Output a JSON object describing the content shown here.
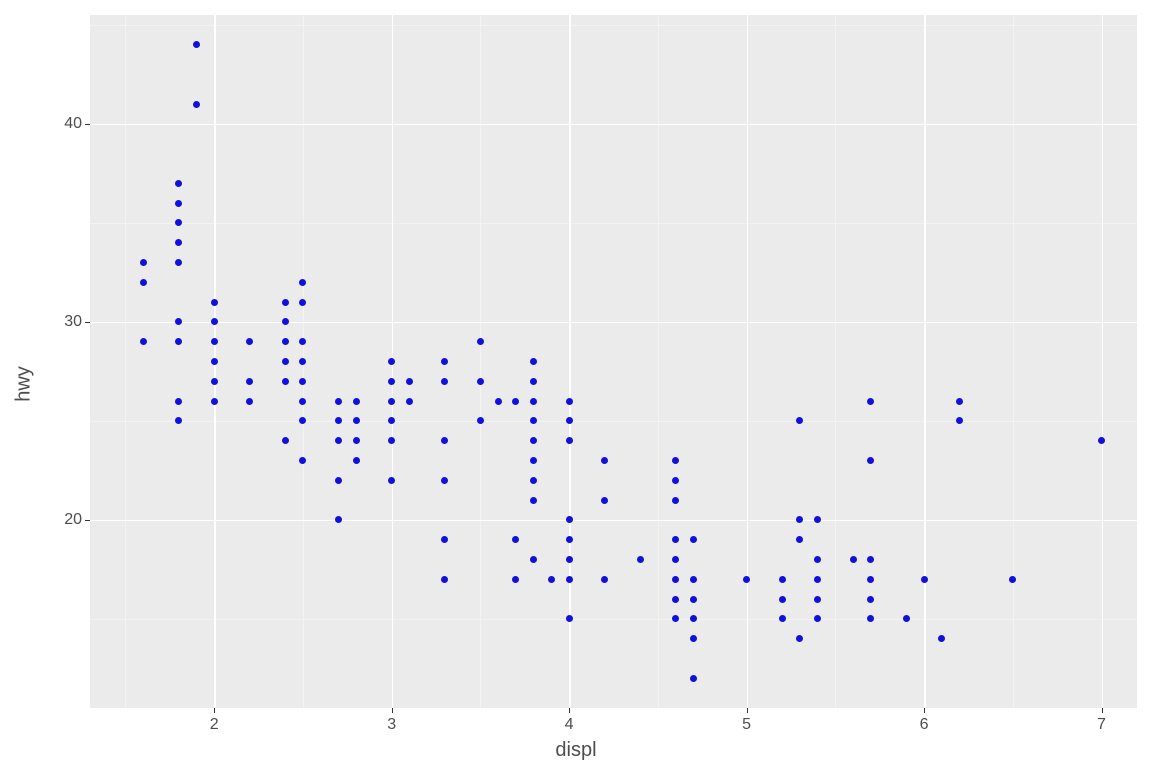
{
  "chart_data": {
    "type": "scatter",
    "xlabel": "displ",
    "ylabel": "hwy",
    "xlim": [
      1.3,
      7.2
    ],
    "ylim": [
      10.5,
      45.5
    ],
    "x_ticks": [
      2,
      3,
      4,
      5,
      6,
      7
    ],
    "y_ticks": [
      20,
      30,
      40
    ],
    "x_minor_ticks": [
      1.5,
      2.5,
      3.5,
      4.5,
      5.5,
      6.5
    ],
    "y_minor_ticks": [
      15,
      25,
      35,
      45
    ],
    "point_color": "#1111dd",
    "points": [
      [
        1.6,
        29
      ],
      [
        1.6,
        32
      ],
      [
        1.6,
        33
      ],
      [
        1.8,
        25
      ],
      [
        1.8,
        26
      ],
      [
        1.8,
        29
      ],
      [
        1.8,
        30
      ],
      [
        1.8,
        33
      ],
      [
        1.8,
        34
      ],
      [
        1.8,
        35
      ],
      [
        1.8,
        36
      ],
      [
        1.8,
        37
      ],
      [
        1.9,
        41
      ],
      [
        1.9,
        44
      ],
      [
        2.0,
        26
      ],
      [
        2.0,
        27
      ],
      [
        2.0,
        28
      ],
      [
        2.0,
        29
      ],
      [
        2.0,
        30
      ],
      [
        2.0,
        31
      ],
      [
        2.2,
        26
      ],
      [
        2.2,
        27
      ],
      [
        2.2,
        29
      ],
      [
        2.4,
        24
      ],
      [
        2.4,
        27
      ],
      [
        2.4,
        28
      ],
      [
        2.4,
        29
      ],
      [
        2.4,
        30
      ],
      [
        2.4,
        31
      ],
      [
        2.5,
        23
      ],
      [
        2.5,
        25
      ],
      [
        2.5,
        26
      ],
      [
        2.5,
        27
      ],
      [
        2.5,
        28
      ],
      [
        2.5,
        29
      ],
      [
        2.5,
        31
      ],
      [
        2.5,
        32
      ],
      [
        2.7,
        20
      ],
      [
        2.7,
        22
      ],
      [
        2.7,
        24
      ],
      [
        2.7,
        25
      ],
      [
        2.7,
        26
      ],
      [
        2.8,
        23
      ],
      [
        2.8,
        24
      ],
      [
        2.8,
        25
      ],
      [
        2.8,
        26
      ],
      [
        3.0,
        22
      ],
      [
        3.0,
        24
      ],
      [
        3.0,
        25
      ],
      [
        3.0,
        26
      ],
      [
        3.0,
        27
      ],
      [
        3.0,
        28
      ],
      [
        3.1,
        26
      ],
      [
        3.1,
        27
      ],
      [
        3.3,
        17
      ],
      [
        3.3,
        19
      ],
      [
        3.3,
        22
      ],
      [
        3.3,
        24
      ],
      [
        3.3,
        27
      ],
      [
        3.3,
        28
      ],
      [
        3.5,
        25
      ],
      [
        3.5,
        27
      ],
      [
        3.5,
        29
      ],
      [
        3.6,
        26
      ],
      [
        3.7,
        17
      ],
      [
        3.7,
        19
      ],
      [
        3.7,
        26
      ],
      [
        3.8,
        18
      ],
      [
        3.8,
        21
      ],
      [
        3.8,
        22
      ],
      [
        3.8,
        23
      ],
      [
        3.8,
        24
      ],
      [
        3.8,
        25
      ],
      [
        3.8,
        26
      ],
      [
        3.8,
        27
      ],
      [
        3.8,
        28
      ],
      [
        3.9,
        17
      ],
      [
        4.0,
        15
      ],
      [
        4.0,
        17
      ],
      [
        4.0,
        18
      ],
      [
        4.0,
        19
      ],
      [
        4.0,
        20
      ],
      [
        4.0,
        24
      ],
      [
        4.0,
        25
      ],
      [
        4.0,
        26
      ],
      [
        4.2,
        17
      ],
      [
        4.2,
        21
      ],
      [
        4.2,
        23
      ],
      [
        4.4,
        18
      ],
      [
        4.6,
        15
      ],
      [
        4.6,
        16
      ],
      [
        4.6,
        17
      ],
      [
        4.6,
        18
      ],
      [
        4.6,
        19
      ],
      [
        4.6,
        21
      ],
      [
        4.6,
        22
      ],
      [
        4.6,
        23
      ],
      [
        4.7,
        12
      ],
      [
        4.7,
        14
      ],
      [
        4.7,
        15
      ],
      [
        4.7,
        16
      ],
      [
        4.7,
        17
      ],
      [
        4.7,
        19
      ],
      [
        5.0,
        17
      ],
      [
        5.2,
        15
      ],
      [
        5.2,
        16
      ],
      [
        5.2,
        17
      ],
      [
        5.3,
        14
      ],
      [
        5.3,
        19
      ],
      [
        5.3,
        20
      ],
      [
        5.3,
        25
      ],
      [
        5.4,
        15
      ],
      [
        5.4,
        16
      ],
      [
        5.4,
        17
      ],
      [
        5.4,
        18
      ],
      [
        5.4,
        20
      ],
      [
        5.6,
        18
      ],
      [
        5.7,
        15
      ],
      [
        5.7,
        16
      ],
      [
        5.7,
        17
      ],
      [
        5.7,
        18
      ],
      [
        5.7,
        23
      ],
      [
        5.7,
        26
      ],
      [
        5.9,
        15
      ],
      [
        6.0,
        17
      ],
      [
        6.1,
        14
      ],
      [
        6.2,
        25
      ],
      [
        6.2,
        26
      ],
      [
        6.5,
        17
      ],
      [
        7.0,
        24
      ]
    ]
  }
}
